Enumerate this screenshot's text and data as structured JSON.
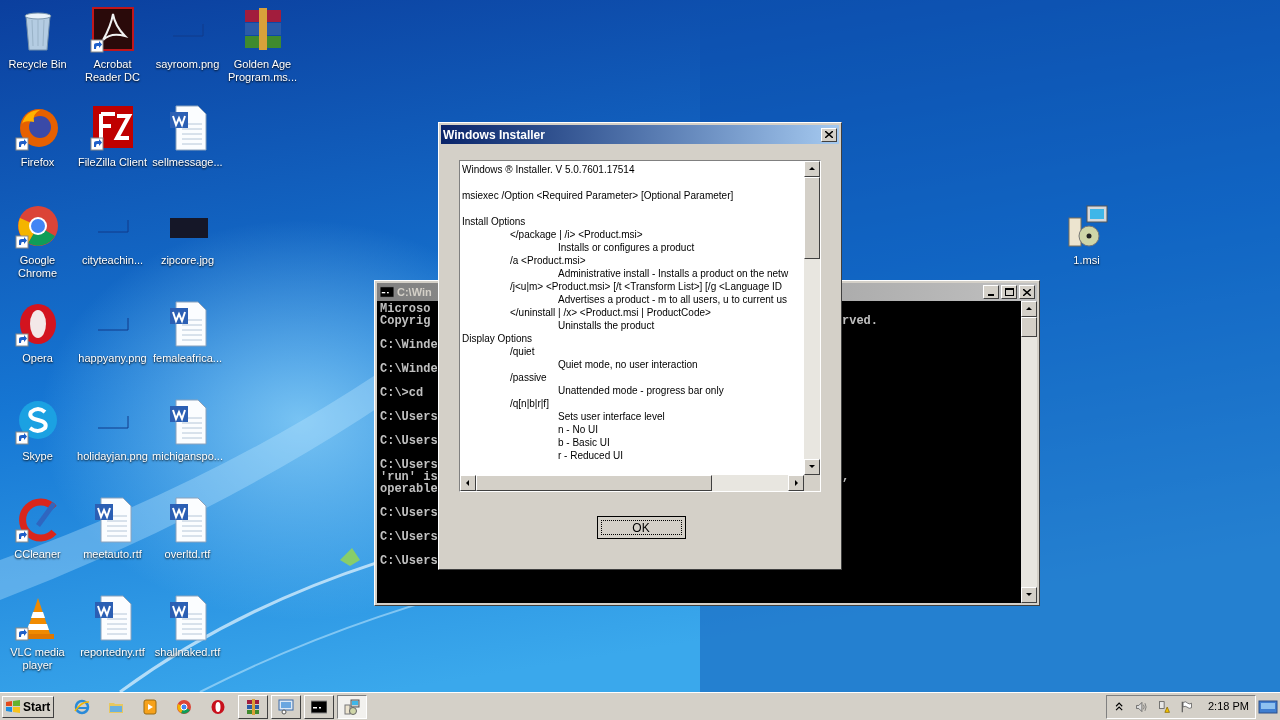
{
  "desktop": {
    "columns": [
      [
        {
          "label": "Recycle Bin",
          "kind": "recycle",
          "shortcut": false
        },
        {
          "label": "Firefox",
          "kind": "firefox",
          "shortcut": true
        },
        {
          "label": "Google Chrome",
          "kind": "chrome",
          "shortcut": true
        },
        {
          "label": "Opera",
          "kind": "opera",
          "shortcut": true
        },
        {
          "label": "Skype",
          "kind": "skype",
          "shortcut": true
        },
        {
          "label": "CCleaner",
          "kind": "ccleaner",
          "shortcut": true
        },
        {
          "label": "VLC media player",
          "kind": "vlc",
          "shortcut": true
        }
      ],
      [
        {
          "label": "Acrobat Reader DC",
          "kind": "acrobat",
          "shortcut": true
        },
        {
          "label": "FileZilla Client",
          "kind": "filezilla",
          "shortcut": true
        },
        {
          "label": "cityteachin...",
          "kind": "png",
          "shortcut": false
        },
        {
          "label": "happyany.png",
          "kind": "png",
          "shortcut": false
        },
        {
          "label": "holidayjan.png",
          "kind": "png",
          "shortcut": false
        },
        {
          "label": "meetauto.rtf",
          "kind": "word",
          "shortcut": false
        },
        {
          "label": "reportedny.rtf",
          "kind": "word",
          "shortcut": false
        }
      ],
      [
        {
          "label": "sayroom.png",
          "kind": "png",
          "shortcut": false
        },
        {
          "label": "sellmessage...",
          "kind": "word",
          "shortcut": false
        },
        {
          "label": "zipcore.jpg",
          "kind": "jpg",
          "shortcut": false
        },
        {
          "label": "femaleafrica...",
          "kind": "word",
          "shortcut": false
        },
        {
          "label": "michiganspo...",
          "kind": "word",
          "shortcut": false
        },
        {
          "label": "overltd.rtf",
          "kind": "word",
          "shortcut": false
        },
        {
          "label": "shallnaked.rtf",
          "kind": "word",
          "shortcut": false
        }
      ],
      [
        {
          "label": "Golden Age Program.ms...",
          "kind": "winrar",
          "shortcut": false
        }
      ]
    ],
    "right_icons": [
      {
        "label": "1.msi",
        "kind": "msi",
        "shortcut": false
      }
    ]
  },
  "console": {
    "title": "C:\\Win",
    "lines": [
      {
        "kind": "text",
        "left": "Microso"
      },
      {
        "kind": "text",
        "left": "Copyrig",
        "right": "rved."
      },
      {
        "kind": "blank"
      },
      {
        "kind": "text",
        "left": "C:\\Winde"
      },
      {
        "kind": "blank"
      },
      {
        "kind": "text",
        "left": "C:\\Winde"
      },
      {
        "kind": "blank"
      },
      {
        "kind": "text",
        "left": "C:\\>cd"
      },
      {
        "kind": "blank"
      },
      {
        "kind": "text",
        "left": "C:\\Users"
      },
      {
        "kind": "blank"
      },
      {
        "kind": "text",
        "left": "C:\\Users"
      },
      {
        "kind": "blank"
      },
      {
        "kind": "text",
        "left": "C:\\Users"
      },
      {
        "kind": "text",
        "left": "'run' is",
        "right": ","
      },
      {
        "kind": "text",
        "left": "operable"
      },
      {
        "kind": "blank"
      },
      {
        "kind": "text",
        "left": "C:\\Users"
      },
      {
        "kind": "blank"
      },
      {
        "kind": "text",
        "left": "C:\\Users"
      },
      {
        "kind": "blank"
      },
      {
        "kind": "text",
        "left": "C:\\Users"
      }
    ]
  },
  "dialog": {
    "title": "Windows Installer",
    "lines": [
      {
        "kind": "text",
        "text": "Windows ® Installer. V 5.0.7601.17514"
      },
      {
        "kind": "blank"
      },
      {
        "kind": "text",
        "text": "msiexec /Option <Required Parameter> [Optional Parameter]"
      },
      {
        "kind": "blank"
      },
      {
        "kind": "text",
        "text": "Install Options",
        "children": [
          {
            "kind": "text",
            "text": "</package | /i> <Product.msi>",
            "children": [
              {
                "kind": "text",
                "text": "Installs or configures a product"
              }
            ]
          },
          {
            "kind": "text",
            "text": "/a <Product.msi>",
            "children": [
              {
                "kind": "text",
                "text": "Administrative install - Installs a product on the netw"
              }
            ]
          },
          {
            "kind": "text",
            "text": "/j<u|m> <Product.msi> [/t <Transform List>] [/g <Language ID",
            "children": [
              {
                "kind": "text",
                "text": "Advertises a product - m to all users, u to current us"
              }
            ]
          },
          {
            "kind": "text",
            "text": "</uninstall | /x> <Product.msi | ProductCode>",
            "children": [
              {
                "kind": "text",
                "text": "Uninstalls the product"
              }
            ]
          }
        ]
      },
      {
        "kind": "text",
        "text": "Display Options",
        "children": [
          {
            "kind": "text",
            "text": "/quiet",
            "children": [
              {
                "kind": "text",
                "text": "Quiet mode, no user interaction"
              }
            ]
          },
          {
            "kind": "text",
            "text": "/passive",
            "children": [
              {
                "kind": "text",
                "text": "Unattended mode - progress bar only"
              }
            ]
          },
          {
            "kind": "text",
            "text": "/q[n|b|r|f]",
            "children": [
              {
                "kind": "text",
                "text": "Sets user interface level"
              },
              {
                "kind": "text",
                "text": "n - No UI"
              },
              {
                "kind": "text",
                "text": "b - Basic UI"
              },
              {
                "kind": "text",
                "text": "r - Reduced UI"
              }
            ]
          }
        ]
      }
    ],
    "button": "OK"
  },
  "taskbar": {
    "start": "Start",
    "quick_launch": [
      {
        "kind": "ie"
      },
      {
        "kind": "folder"
      },
      {
        "kind": "media"
      },
      {
        "kind": "chrome"
      },
      {
        "kind": "opera"
      }
    ],
    "tasks": [
      {
        "kind": "winrar",
        "selected": false
      },
      {
        "kind": "remote",
        "selected": false
      },
      {
        "kind": "cmd",
        "selected": false
      },
      {
        "kind": "msi",
        "selected": true
      }
    ],
    "tray": [
      {
        "kind": "chevron"
      },
      {
        "kind": "speaker"
      },
      {
        "kind": "network"
      },
      {
        "kind": "flag"
      }
    ],
    "clock": "2:18 PM"
  }
}
